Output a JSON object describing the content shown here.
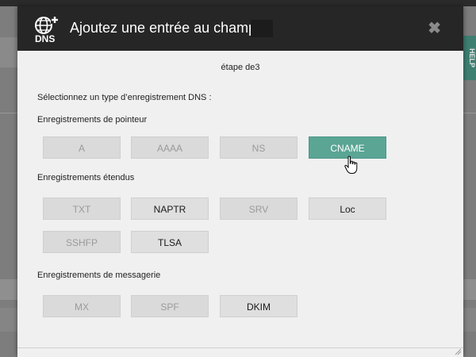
{
  "modal": {
    "title": "Ajoutez une entrée au champ :",
    "close_glyph": "✖",
    "logo_text": "DNS",
    "step": "étape de3",
    "prompt": "Sélectionnez un type d’enregistrement DNS :"
  },
  "background": {
    "help_label": "HELP"
  },
  "sections": [
    {
      "label": "Enregistrements de pointeur"
    },
    {
      "label": "Enregistrements étendus"
    },
    {
      "label": "Enregistrements de messagerie"
    }
  ],
  "buttons": {
    "a": "A",
    "aaaa": "AAAA",
    "ns": "NS",
    "cname": "CNAME",
    "txt": "TXT",
    "naptr": "NAPTR",
    "srv": "SRV",
    "loc": "Loc",
    "sshfp": "SSHFP",
    "tlsa": "TLSA",
    "mx": "MX",
    "spf": "SPF",
    "dkim": "DKIM"
  },
  "colors": {
    "selected": "#5ba595",
    "header": "#262626",
    "disabled_text": "#9a9a9a"
  },
  "icons": [
    "dns-globe-icon",
    "close-icon",
    "hand-pointer-icon"
  ]
}
